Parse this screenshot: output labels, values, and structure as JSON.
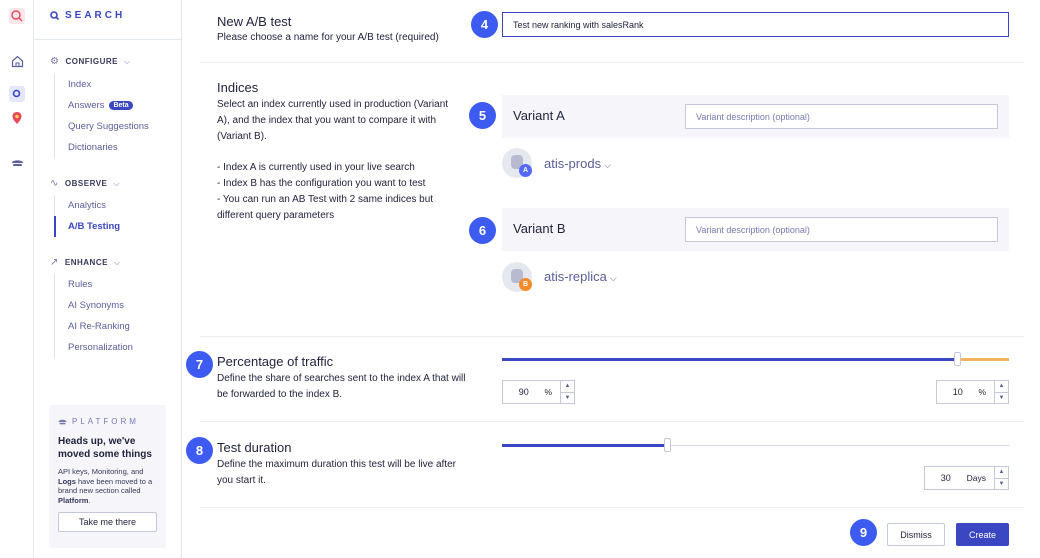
{
  "rail": {
    "icons": [
      "search-icon",
      "home-icon",
      "search-app-icon",
      "recommend-icon",
      "platform-icon"
    ]
  },
  "sidebar": {
    "brand": "SEARCH",
    "sections": [
      {
        "title": "CONFIGURE",
        "items": [
          "Index",
          "Answers",
          "Query Suggestions",
          "Dictionaries"
        ],
        "badge": "Beta"
      },
      {
        "title": "OBSERVE",
        "items": [
          "Analytics",
          "A/B Testing"
        ]
      },
      {
        "title": "ENHANCE",
        "items": [
          "Rules",
          "AI Synonyms",
          "AI Re-Ranking",
          "Personalization"
        ]
      }
    ],
    "active_item": "A/B Testing",
    "platform": {
      "title": "PLATFORM",
      "heading": "Heads up, we've moved some things",
      "body_pre": "API keys, Monitoring, and ",
      "body_bold1": "Logs",
      "body_mid": " have been moved to a brand new section called ",
      "body_bold2": "Platform",
      "body_post": ".",
      "button": "Take me there"
    }
  },
  "form": {
    "name": {
      "step": "4",
      "title": "New A/B test",
      "description": "Please choose a name for your A/B test (required)",
      "value": "Test new ranking with salesRank"
    },
    "indices": {
      "title": "Indices",
      "description": "Select an index currently used in production (Variant A), and the index that you want to compare it with (Variant B).",
      "bullets": [
        "- Index A is currently used in your live search",
        "- Index B has the configuration you want to test",
        "- You can run an AB Test with 2 same indices but different query parameters"
      ],
      "variant_a": {
        "step": "5",
        "label": "Variant A",
        "placeholder": "Variant description (optional)",
        "index": "atis-prods",
        "badge": "A",
        "badge_color": "#5468ff"
      },
      "variant_b": {
        "step": "6",
        "label": "Variant B",
        "placeholder": "Variant description (optional)",
        "index": "atis-replica",
        "badge": "B",
        "badge_color": "#f18b2c"
      }
    },
    "traffic": {
      "step": "7",
      "title": "Percentage of traffic",
      "description": "Define the share of searches sent to the index A that will be forwarded to the index B.",
      "value_a": "90",
      "value_b": "10",
      "unit": "%",
      "split_fraction": 0.9,
      "color_a": "#3a46c2",
      "color_b": "#f0b35e"
    },
    "duration": {
      "step": "8",
      "title": "Test duration",
      "description": "Define the maximum duration this test will be live after you start it.",
      "value": "30",
      "unit": "Days",
      "fraction": 0.327
    },
    "actions": {
      "step": "9",
      "dismiss": "Dismiss",
      "create": "Create"
    }
  }
}
